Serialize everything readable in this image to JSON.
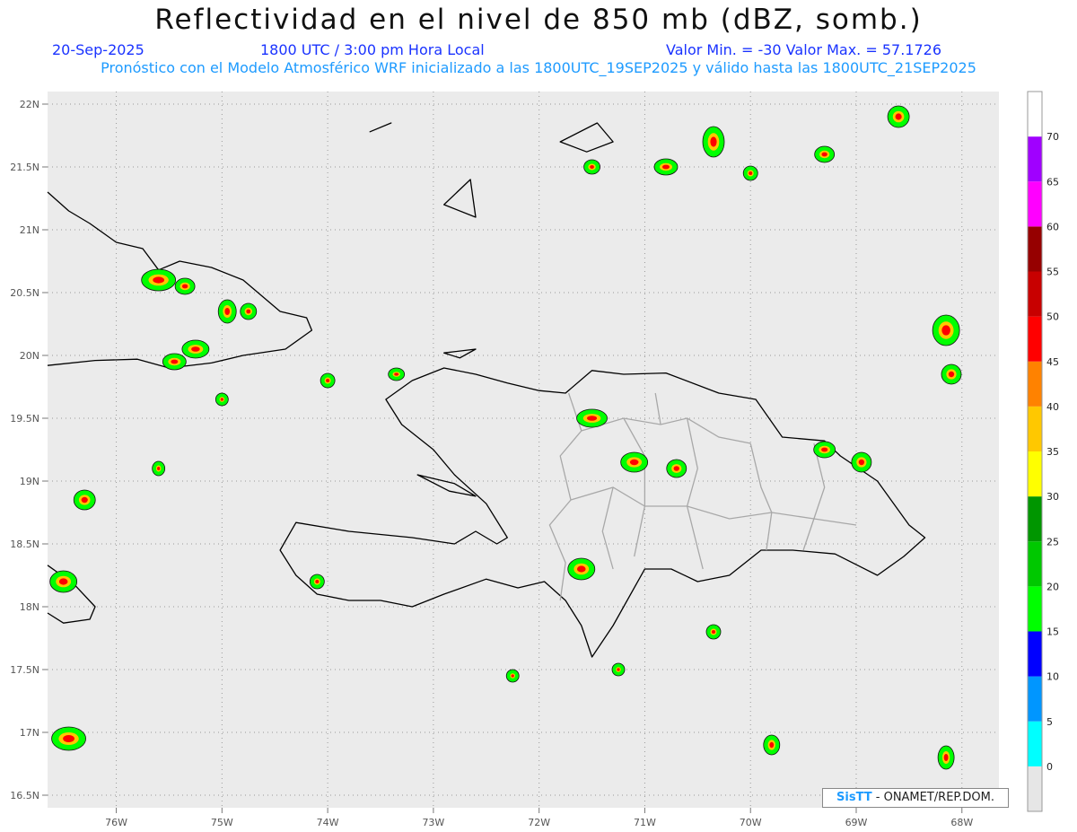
{
  "header": {
    "title": "Reflectividad en el nivel de 850 mb (dBZ, somb.)",
    "date": "20-Sep-2025",
    "time": "1800 UTC / 3:00 pm Hora Local",
    "minmax": "Valor Min. = -30  Valor Max. = 57.1726",
    "forecast": "Pronóstico con el Modelo Atmosférico WRF inicializado a las 1800UTC_19SEP2025 y válido hasta las  1800UTC_21SEP2025"
  },
  "credit": {
    "logo": "SisTT",
    "text": " - ONAMET/REP.DOM."
  },
  "map": {
    "lat_labels": [
      "22N",
      "21.5N",
      "21N",
      "20.5N",
      "20N",
      "19.5N",
      "19N",
      "18.5N",
      "18N",
      "17.5N",
      "17N",
      "16.5N"
    ],
    "lat_values": [
      22,
      21.5,
      21,
      20.5,
      20,
      19.5,
      19,
      18.5,
      18,
      17.5,
      17,
      16.5
    ],
    "lon_labels": [
      "76W",
      "75W",
      "74W",
      "73W",
      "72W",
      "71W",
      "70W",
      "69W",
      "68W"
    ],
    "lon_values": [
      -76,
      -75,
      -74,
      -73,
      -72,
      -71,
      -70,
      -69,
      -68
    ],
    "lon_range": [
      -76.65,
      -67.65
    ],
    "lat_range": [
      16.4,
      22.1
    ],
    "ocean_color": "#ebebeb",
    "coast_color": "#000000",
    "border_color": "#a8a8a8"
  },
  "colorbar": {
    "levels": [
      "0",
      "5",
      "10",
      "15",
      "20",
      "25",
      "30",
      "35",
      "40",
      "45",
      "50",
      "55",
      "60",
      "65",
      "70"
    ],
    "colors": [
      "#e6e6e6",
      "#00ffff",
      "#0096ff",
      "#0000ff",
      "#00ff00",
      "#00c800",
      "#009600",
      "#ffff00",
      "#ffc800",
      "#ff8200",
      "#ff0000",
      "#c80000",
      "#960000",
      "#ff00ff",
      "#a000ff",
      "#ffffff"
    ]
  }
}
